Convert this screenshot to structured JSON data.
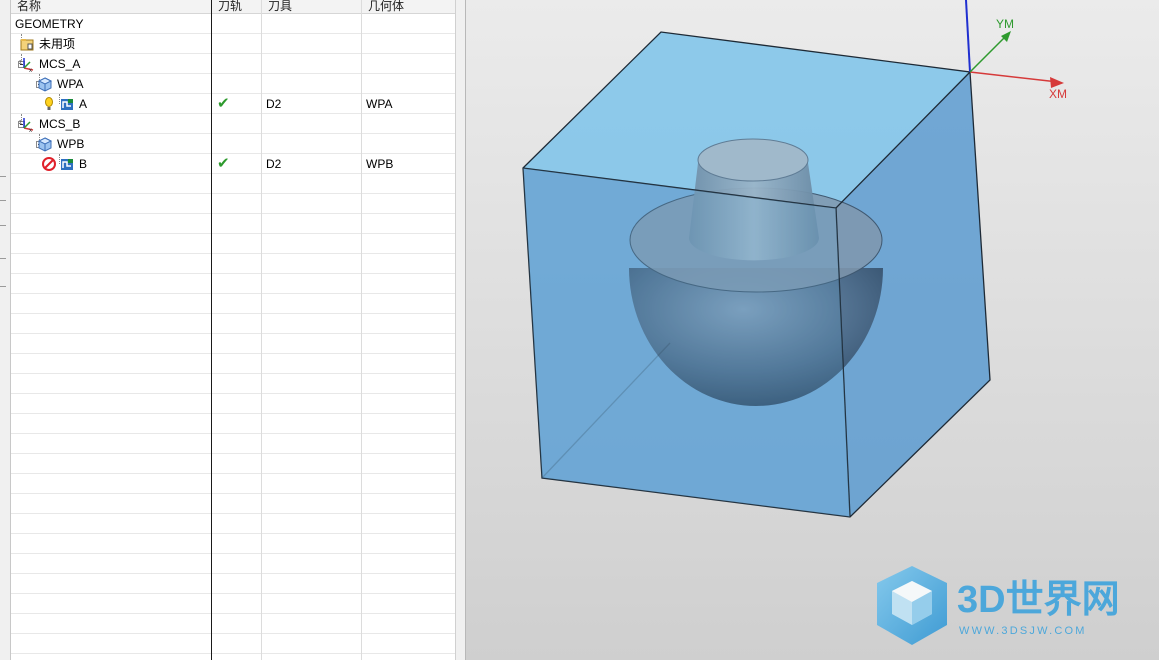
{
  "columns": {
    "name": "名称",
    "toolpath": "刀轨",
    "tool": "刀具",
    "geometry": "几何体"
  },
  "tree": [
    {
      "name": "GEOMETRY",
      "toolpath": "",
      "tool": "",
      "geometry": ""
    },
    {
      "name": "未用项",
      "toolpath": "",
      "tool": "",
      "geometry": ""
    },
    {
      "name": "MCS_A",
      "toolpath": "",
      "tool": "",
      "geometry": ""
    },
    {
      "name": "WPA",
      "toolpath": "",
      "tool": "",
      "geometry": ""
    },
    {
      "name": "A",
      "toolpath": "✔",
      "tool": "D2",
      "geometry": "WPA",
      "status": "needs-regeneration"
    },
    {
      "name": "MCS_B",
      "toolpath": "",
      "tool": "",
      "geometry": ""
    },
    {
      "name": "WPB",
      "toolpath": "",
      "tool": "",
      "geometry": ""
    },
    {
      "name": "B",
      "toolpath": "✔",
      "tool": "D2",
      "geometry": "WPB",
      "status": "suppressed"
    }
  ],
  "viewport": {
    "axes": {
      "y_label": "YM",
      "x_label": "XM"
    },
    "watermark": {
      "title": "3D世界网",
      "url": "WWW.3DSJW.COM"
    }
  },
  "colors": {
    "check": "#2e9a2e",
    "axis_x": "#d63a3a",
    "axis_y": "#2e9a2e",
    "axis_z": "#1f2fd0",
    "block": "#6ab4e6",
    "sphere": "#3d5a78",
    "watermark": "#3ea3dc"
  }
}
